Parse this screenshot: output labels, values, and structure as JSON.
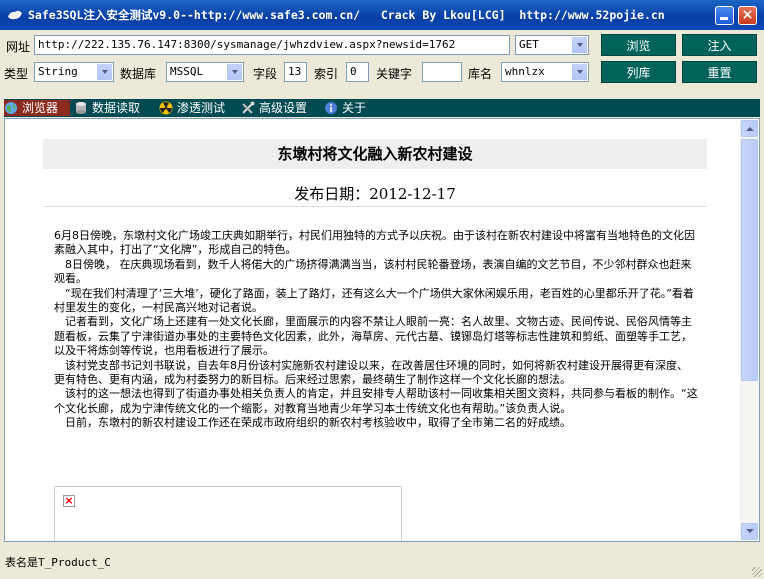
{
  "window": {
    "title": "Safe3SQL注入安全测试v9.0--http://www.safe3.com.cn/   Crack By Lkou[LCG]  http://www.52pojie.cn",
    "minimize_icon": "minimize-icon",
    "close_label": "×"
  },
  "toolbar": {
    "url_label": "网址",
    "url_value": "http://222.135.76.147:8300/sysmanage/jwhzdview.aspx?newsid=1762",
    "method_value": "GET",
    "browse_label": "浏览",
    "inject_label": "注入",
    "type_label": "类型",
    "type_value": "String",
    "db_label": "数据库",
    "db_value": "MSSQL",
    "field_label": "字段",
    "field_value": "13",
    "index_label": "索引",
    "index_value": "0",
    "keyword_label": "关键字",
    "keyword_value": "",
    "dbname_label": "库名",
    "dbname_value": "whnlzx",
    "listdb_label": "列库",
    "reset_label": "重置"
  },
  "tabs": [
    {
      "label": "浏览器",
      "icon": "globe-icon",
      "active": true
    },
    {
      "label": "数据读取",
      "icon": "database-icon",
      "active": false
    },
    {
      "label": "渗透测试",
      "icon": "radiation-icon",
      "active": false
    },
    {
      "label": "高级设置",
      "icon": "tools-icon",
      "active": false
    },
    {
      "label": "关于",
      "icon": "info-icon",
      "active": false
    }
  ],
  "article": {
    "title": "东墩村将文化融入新农村建设",
    "pubdate": "发布日期：2012-12-17",
    "paragraphs": [
      "6月8日傍晚，东墩村文化广场竣工庆典如期举行，村民们用独特的方式予以庆祝。由于该村在新农村建设中将富有当地特色的文化因素融入其中，打出了“文化牌”，形成自己的特色。",
      "　8日傍晚， 在庆典现场看到，数千人将偌大的广场挤得满满当当，该村村民轮番登场，表演自编的文艺节目，不少邻村群众也赶来观看。",
      "　“现在我们村清理了‘三大堆’，硬化了路面，装上了路灯，还有这么大一个广场供大家休闲娱乐用，老百姓的心里都乐开了花。”看着村里发生的变化，一村民高兴地对记者说。",
      "　记者看到，文化广场上还建有一处文化长廊，里面展示的内容不禁让人眼前一亮：名人故里、文物古迹、民间传说、民俗风情等主题看板，云集了宁津街道办事处的主要特色文化因素，此外，海草房、元代古墓、镆铘岛灯塔等标志性建筑和剪纸、面塑等手工艺，以及干将炼剑等传说，也用看板进行了展示。",
      "　该村党支部书记刘书联说，自去年8月份该村实施新农村建设以来，在改善居住环境的同时，如何将新农村建设开展得更有深度、更有特色、更有内涵，成为村委努力的新目标。后来经过思索，最终萌生了制作这样一个文化长廊的想法。",
      "　该村的这一想法也得到了街道办事处相关负责人的肯定，并且安排专人帮助该村一同收集相关图文资料，共同参与看板的制作。“这个文化长廊，成为宁津传统文化的一个缩影，对教育当地青少年学习本土传统文化也有帮助。”该负责人说。",
      "　日前，东墩村的新农村建设工作还在荣成市政府组织的新农村考核验收中，取得了全市第二名的好成绩。"
    ]
  },
  "status": {
    "text": "表名是T_Product_C"
  }
}
